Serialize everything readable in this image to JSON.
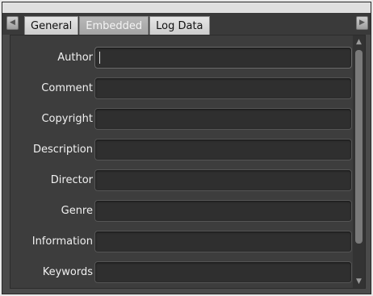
{
  "tabs": [
    {
      "label": "General",
      "active": false
    },
    {
      "label": "Embedded",
      "active": true
    },
    {
      "label": "Log Data",
      "active": false
    }
  ],
  "fields": [
    {
      "label": "Author",
      "value": "",
      "focused": true
    },
    {
      "label": "Comment",
      "value": ""
    },
    {
      "label": "Copyright",
      "value": ""
    },
    {
      "label": "Description",
      "value": ""
    },
    {
      "label": "Director",
      "value": ""
    },
    {
      "label": "Genre",
      "value": ""
    },
    {
      "label": "Information",
      "value": ""
    },
    {
      "label": "Keywords",
      "value": ""
    }
  ],
  "icons": {
    "tab_scroll_left": "chevron-left-icon",
    "tab_scroll_right": "chevron-right-icon",
    "scroll_up": "triangle-up-icon",
    "scroll_down": "triangle-down-icon"
  },
  "colors": {
    "panel_bg": "#3d3d3d",
    "field_bg": "#2f2f2f",
    "label_text": "#f0f0f0",
    "active_tab": "#a9a9a9"
  }
}
